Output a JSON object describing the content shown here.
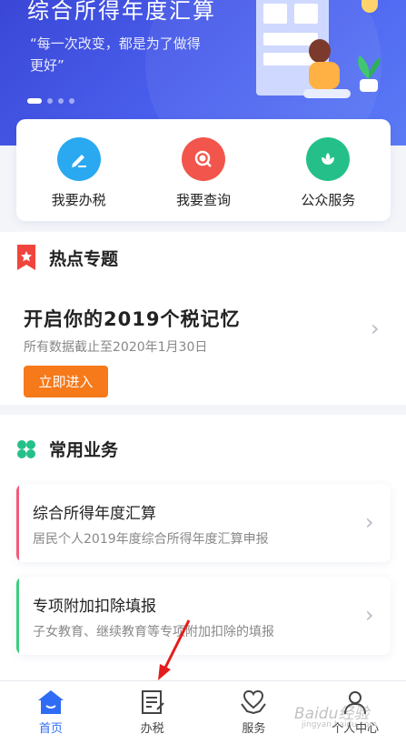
{
  "banner": {
    "title": "综合所得年度汇算",
    "subtitle": "“每一次改变，都是为了做得更好”",
    "slides": 4,
    "active_slide": 1
  },
  "quick_actions": [
    {
      "label": "我要办税",
      "icon": "edit-icon",
      "color": "#2aa9f0"
    },
    {
      "label": "我要查询",
      "icon": "search-icon",
      "color": "#f2554c"
    },
    {
      "label": "公众服务",
      "icon": "flower-icon",
      "color": "#25c08a"
    }
  ],
  "hot_section": {
    "heading": "热点专题",
    "topic_title": "开启你的2019个税记忆",
    "topic_date": "所有数据截止至2020年1月30日",
    "enter_button": "立即进入"
  },
  "common_section": {
    "heading": "常用业务",
    "items": [
      {
        "title": "综合所得年度汇算",
        "desc": "居民个人2019年度综合所得年度汇算申报",
        "accent": "#f35a78"
      },
      {
        "title": "专项附加扣除填报",
        "desc": "子女教育、继续教育等专项附加扣除的填报",
        "accent": "#3ccf7d"
      }
    ]
  },
  "bottom_nav": [
    {
      "label": "首页",
      "icon": "home-icon",
      "active": true
    },
    {
      "label": "办税",
      "icon": "document-icon",
      "active": false
    },
    {
      "label": "服务",
      "icon": "heart-hands-icon",
      "active": false
    },
    {
      "label": "个人中心",
      "icon": "user-icon",
      "active": false
    }
  ],
  "watermark": {
    "brand": "Baidu经验",
    "domain": "jingyan.baidu.com"
  },
  "colors": {
    "primary": "#2f6cf5",
    "orange": "#f6791a",
    "banner": "#4c62f0"
  }
}
